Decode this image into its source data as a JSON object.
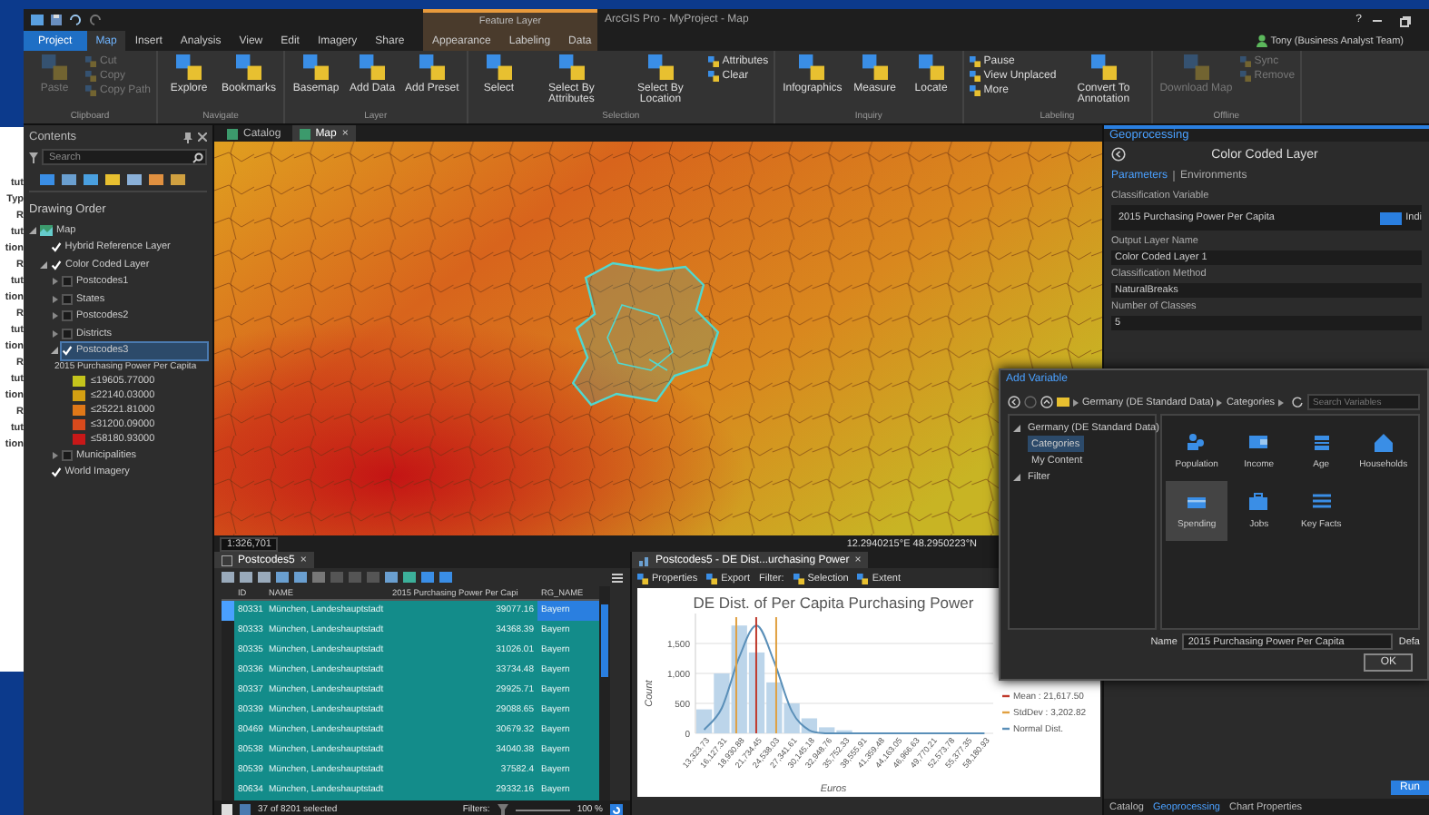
{
  "background_document": {
    "fragments": [
      "tut",
      "Typ",
      "R",
      "tut",
      "tion",
      "R",
      "tut",
      "tion",
      "R",
      "tut",
      "tion",
      "R",
      "tut",
      "tion",
      "R",
      "tut",
      "tion"
    ]
  },
  "window": {
    "title": "ArcGIS Pro - MyProject - Map",
    "context_title": "Feature Layer",
    "help": "?",
    "user": "Tony (Business Analyst Team)"
  },
  "ribbon_tabs": [
    {
      "label": "Project",
      "kind": "backstage",
      "selected": false
    },
    {
      "label": "Map",
      "kind": "core",
      "selected": true
    },
    {
      "label": "Insert",
      "kind": "core",
      "selected": false
    },
    {
      "label": "Analysis",
      "kind": "core",
      "selected": false
    },
    {
      "label": "View",
      "kind": "core",
      "selected": false
    },
    {
      "label": "Edit",
      "kind": "core",
      "selected": false
    },
    {
      "label": "Imagery",
      "kind": "core",
      "selected": false
    },
    {
      "label": "Share",
      "kind": "core",
      "selected": false
    },
    {
      "label": "Appearance",
      "kind": "context",
      "selected": false
    },
    {
      "label": "Labeling",
      "kind": "context",
      "selected": false
    },
    {
      "label": "Data",
      "kind": "context",
      "selected": false
    }
  ],
  "ribbon_groups": [
    {
      "label": "Clipboard",
      "buttons": [
        {
          "label": "Paste",
          "kind": "large",
          "disabled": true
        },
        {
          "label": "Cut",
          "kind": "small",
          "disabled": true
        },
        {
          "label": "Copy",
          "kind": "small",
          "disabled": true
        },
        {
          "label": "Copy Path",
          "kind": "small",
          "disabled": true
        }
      ]
    },
    {
      "label": "Navigate",
      "buttons": [
        {
          "label": "Explore",
          "kind": "large",
          "disabled": false
        },
        {
          "label": "Bookmarks",
          "kind": "large",
          "disabled": false
        }
      ]
    },
    {
      "label": "Layer",
      "buttons": [
        {
          "label": "Basemap",
          "kind": "large",
          "disabled": false
        },
        {
          "label": "Add Data",
          "kind": "large",
          "disabled": false
        },
        {
          "label": "Add Preset",
          "kind": "large",
          "disabled": false
        }
      ]
    },
    {
      "label": "Selection",
      "buttons": [
        {
          "label": "Select",
          "kind": "large",
          "disabled": false
        },
        {
          "label": "Select By Attributes",
          "kind": "large",
          "disabled": false
        },
        {
          "label": "Select By Location",
          "kind": "large",
          "disabled": false
        },
        {
          "label": "Attributes",
          "kind": "small",
          "disabled": false
        },
        {
          "label": "Clear",
          "kind": "small",
          "disabled": false
        }
      ]
    },
    {
      "label": "Inquiry",
      "buttons": [
        {
          "label": "Infographics",
          "kind": "large",
          "disabled": false
        },
        {
          "label": "Measure",
          "kind": "large",
          "disabled": false
        },
        {
          "label": "Locate",
          "kind": "large",
          "disabled": false
        }
      ]
    },
    {
      "label": "Labeling",
      "buttons": [
        {
          "label": "Pause",
          "kind": "small",
          "disabled": false
        },
        {
          "label": "View Unplaced",
          "kind": "small",
          "disabled": false
        },
        {
          "label": "More",
          "kind": "small",
          "disabled": false
        },
        {
          "label": "Convert To Annotation",
          "kind": "large",
          "disabled": false
        }
      ]
    },
    {
      "label": "Offline",
      "buttons": [
        {
          "label": "Download Map",
          "kind": "large",
          "disabled": true
        },
        {
          "label": "Sync",
          "kind": "small",
          "disabled": true
        },
        {
          "label": "Remove",
          "kind": "small",
          "disabled": true
        }
      ]
    }
  ],
  "contents": {
    "title": "Contents",
    "search": {
      "placeholder": "Search"
    },
    "heading": "Drawing Order",
    "tree": [
      {
        "label": "Map",
        "kind": "map",
        "selected": false,
        "expanded": true,
        "children": [
          {
            "label": "Hybrid Reference Layer",
            "kind": "layer",
            "selected": false,
            "checked": true
          },
          {
            "label": "Color Coded Layer",
            "kind": "layer",
            "selected": false,
            "checked": true,
            "expanded": true,
            "children": [
              {
                "label": "Postcodes1",
                "kind": "layer",
                "selected": false,
                "checked": false,
                "expanded": false
              },
              {
                "label": "States",
                "kind": "layer",
                "selected": false,
                "checked": false,
                "expanded": false
              },
              {
                "label": "Postcodes2",
                "kind": "layer",
                "selected": false,
                "checked": false,
                "expanded": false
              },
              {
                "label": "Districts",
                "kind": "layer",
                "selected": false,
                "checked": false,
                "expanded": false
              },
              {
                "label": "Postcodes3",
                "kind": "layer",
                "selected": true,
                "checked": true,
                "expanded": true,
                "legend": {
                  "title": "2015 Purchasing Power Per Capita",
                  "classes": [
                    {
                      "label": "≤19605.77000",
                      "color": "#c4c41c"
                    },
                    {
                      "label": "≤22140.03000",
                      "color": "#d4a012"
                    },
                    {
                      "label": "≤25221.81000",
                      "color": "#e07818"
                    },
                    {
                      "label": "≤31200.09000",
                      "color": "#d84a1c"
                    },
                    {
                      "label": "≤58180.93000",
                      "color": "#c81818"
                    }
                  ]
                }
              },
              {
                "label": "Municipalities",
                "kind": "layer",
                "selected": false,
                "checked": false,
                "expanded": false
              }
            ]
          },
          {
            "label": "World Imagery",
            "kind": "layer",
            "selected": false,
            "checked": true
          }
        ]
      }
    ]
  },
  "map_view": {
    "tabs": [
      {
        "label": "Catalog",
        "selected": false
      },
      {
        "label": "Map",
        "selected": true,
        "close": "×"
      }
    ],
    "scale": "1:326,701",
    "coordinates": "12.2940215°E 48.2950223°N"
  },
  "attribute_table": {
    "tab": {
      "label": "Postcodes5",
      "close": "×"
    },
    "columns": [
      "ID",
      "NAME",
      "2015 Purchasing Power Per Capi",
      "RG_NAME"
    ],
    "rows": [
      {
        "cells": [
          "80331",
          "München, Landeshauptstadt",
          "39077.16",
          "Bayern"
        ],
        "selected": true,
        "current": true
      },
      {
        "cells": [
          "80333",
          "München, Landeshauptstadt",
          "34368.39",
          "Bayern"
        ],
        "selected": true,
        "current": false
      },
      {
        "cells": [
          "80335",
          "München, Landeshauptstadt",
          "31026.01",
          "Bayern"
        ],
        "selected": true,
        "current": false
      },
      {
        "cells": [
          "80336",
          "München, Landeshauptstadt",
          "33734.48",
          "Bayern"
        ],
        "selected": true,
        "current": false
      },
      {
        "cells": [
          "80337",
          "München, Landeshauptstadt",
          "29925.71",
          "Bayern"
        ],
        "selected": true,
        "current": false
      },
      {
        "cells": [
          "80339",
          "München, Landeshauptstadt",
          "29088.65",
          "Bayern"
        ],
        "selected": true,
        "current": false
      },
      {
        "cells": [
          "80469",
          "München, Landeshauptstadt",
          "30679.32",
          "Bayern"
        ],
        "selected": true,
        "current": false
      },
      {
        "cells": [
          "80538",
          "München, Landeshauptstadt",
          "34040.38",
          "Bayern"
        ],
        "selected": true,
        "current": false
      },
      {
        "cells": [
          "80539",
          "München, Landeshauptstadt",
          "37582.4",
          "Bayern"
        ],
        "selected": true,
        "current": false
      },
      {
        "cells": [
          "80634",
          "München, Landeshauptstadt",
          "29332.16",
          "Bayern"
        ],
        "selected": true,
        "current": false
      }
    ],
    "status": "37 of 8201 selected",
    "filters_label": "Filters:",
    "zoom": "100 %"
  },
  "chart_view": {
    "tab": {
      "label": "Postcodes5 - DE Dist...urchasing Power",
      "close": "×"
    },
    "toolbar": [
      {
        "label": "Properties",
        "kind": "button"
      },
      {
        "label": "Export",
        "kind": "button"
      },
      {
        "label": "Filter:",
        "kind": "label"
      },
      {
        "label": "Selection",
        "kind": "button"
      },
      {
        "label": "Extent",
        "kind": "button"
      }
    ],
    "chart_data": {
      "type": "bar",
      "title": "DE Dist. of Per Capita Purchasing Power",
      "xlabel": "Euros",
      "ylabel": "Count",
      "categories": [
        "13,323.73",
        "16,127.31",
        "18,930.88",
        "21,734.45",
        "24,538.03",
        "27,341.61",
        "30,145.18",
        "32,948.76",
        "35,752.33",
        "38,555.91",
        "41,359.48",
        "44,163.05",
        "46,966.63",
        "49,770.21",
        "52,573.78",
        "55,377.35",
        "58,180.93"
      ],
      "series": [
        {
          "color": "#bcd5ea",
          "values": [
            400,
            1000,
            1800,
            1350,
            850,
            500,
            250,
            100,
            50,
            0,
            0,
            0,
            0,
            0,
            0,
            0,
            0
          ]
        },
        {
          "name": "Normal Dist.",
          "type": "line",
          "color": "#5a8fb8",
          "values": [
            60,
            420,
            1270,
            1800,
            1190,
            370,
            50,
            0,
            0,
            0,
            0,
            0,
            0,
            0,
            0,
            0,
            0
          ]
        }
      ],
      "yticks": [
        {
          "value": 0,
          "label": "0"
        },
        {
          "value": 500,
          "label": "500"
        },
        {
          "value": 1000,
          "label": "1,000"
        },
        {
          "value": 1500,
          "label": "1,500"
        }
      ],
      "ylim": [
        0,
        2000
      ],
      "grid": true,
      "annotations": [
        "Mean : 21,617.50",
        "StdDev : 3,202.82"
      ]
    }
  },
  "geoprocessing": {
    "title": "Geoprocessing",
    "tool": "Color Coded Layer",
    "tabs": [
      {
        "label": "Parameters",
        "selected": true
      },
      {
        "label": "Environments",
        "selected": false
      }
    ],
    "parameters": [
      {
        "label": "Classification Variable",
        "value": "2015 Purchasing Power Per Capita",
        "kind": "variable",
        "action": "Indi"
      },
      {
        "label": "Output Layer Name",
        "value": "Color Coded Layer 1",
        "kind": "text"
      },
      {
        "label": "Classification Method",
        "value": "NaturalBreaks",
        "kind": "text"
      },
      {
        "label": "Number of Classes",
        "value": "5",
        "kind": "text"
      }
    ],
    "run": "Run",
    "bottom_tabs": [
      {
        "label": "Catalog",
        "selected": false
      },
      {
        "label": "Geoprocessing",
        "selected": true
      },
      {
        "label": "Chart Properties",
        "selected": false
      }
    ]
  },
  "add_variable_dialog": {
    "title": "Add Variable",
    "breadcrumb": [
      "Germany (DE Standard Data)",
      "Categories"
    ],
    "search": {
      "placeholder": "Search Variables"
    },
    "tree": [
      {
        "label": "Germany (DE Standard Data)",
        "selected": false,
        "expanded": true,
        "children": [
          {
            "label": "Categories",
            "selected": true
          },
          {
            "label": "My Content",
            "selected": false
          }
        ]
      },
      {
        "label": "Filter",
        "selected": false,
        "expanded": true
      }
    ],
    "categories": [
      {
        "label": "Population",
        "selected": false
      },
      {
        "label": "Income",
        "selected": false
      },
      {
        "label": "Age",
        "selected": false
      },
      {
        "label": "Households",
        "selected": false
      },
      {
        "label": "Spending",
        "selected": true
      },
      {
        "label": "Jobs",
        "selected": false
      },
      {
        "label": "Key Facts",
        "selected": false
      }
    ],
    "name_label": "Name",
    "name_value": "2015 Purchasing Power Per Capita",
    "default_label": "Defa",
    "ok": "OK"
  }
}
